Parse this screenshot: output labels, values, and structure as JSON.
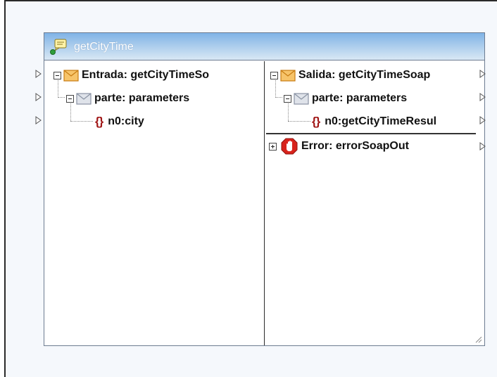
{
  "component": {
    "title": "getCityTime",
    "input": {
      "root_label": "Entrada: getCityTimeSo",
      "part_label": "parte: parameters",
      "element_label": "n0:city"
    },
    "output": {
      "root_label": "Salida: getCityTimeSoap",
      "part_label": "parte: parameters",
      "element_label": "n0:getCityTimeResul",
      "fault_label": "Error: errorSoapOut"
    }
  },
  "icons": {
    "title": "web-service-call-icon",
    "message": "envelope-icon",
    "part": "envelope-icon",
    "element": "element-braces-icon",
    "fault": "error-stop-hand-icon"
  },
  "colors": {
    "title_gradient_top": "#7fb3e6",
    "title_gradient_bottom": "#d9e8f4",
    "envelope_orange": "#f0a43a",
    "envelope_gray": "#b8bec8",
    "element_red": "#a01616",
    "fault_red": "#d8231c"
  }
}
